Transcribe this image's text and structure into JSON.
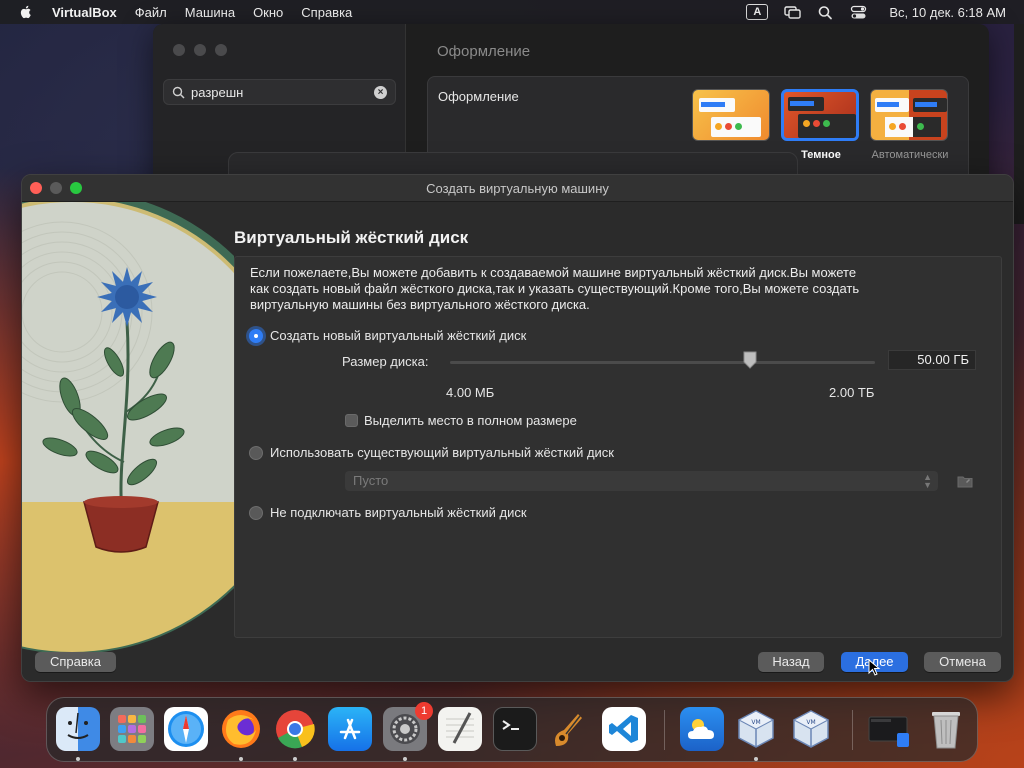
{
  "menubar": {
    "app_name": "VirtualBox",
    "items": [
      "Файл",
      "Машина",
      "Окно",
      "Справка"
    ],
    "kb_layout": "A",
    "clock": "Вс, 10 дек. 6:18 AM"
  },
  "settings_window": {
    "search_value": "разрешн",
    "title": "Оформление",
    "appearance_label": "Оформление",
    "themes": [
      {
        "name": "",
        "selected": false
      },
      {
        "name": "Темное",
        "selected": true
      },
      {
        "name": "Автоматически",
        "selected": false
      }
    ]
  },
  "dialog": {
    "title": "Создать виртуальную машину",
    "heading": "Виртуальный жёсткий диск",
    "description": "Если пожелаете,Вы можете добавить к создаваемой машине виртуальный жёсткий диск.Вы можете как создать новый файл жёсткого диска,так и указать существующий.Кроме того,Вы можете создать виртуальную машины без виртуального жёсткого диска.",
    "option_create": "Создать новый виртуальный жёсткий диск",
    "size_label": "Размер диска:",
    "size_value": "50.00 ГБ",
    "size_slider_fraction": 0.705,
    "range_min": "4.00 МБ",
    "range_max": "2.00 ТБ",
    "preallocate_label": "Выделить место в полном размере",
    "preallocate_checked": false,
    "option_existing": "Использовать существующий виртуальный жёсткий диск",
    "existing_placeholder": "Пусто",
    "option_none": "Не подключать виртуальный жёсткий диск",
    "selected_option": "create",
    "buttons": {
      "help": "Справка",
      "back": "Назад",
      "next": "Далее",
      "cancel": "Отмена"
    }
  },
  "dock": {
    "apps": [
      {
        "icon": "finder-icon",
        "running": true
      },
      {
        "icon": "launchpad-icon",
        "running": false
      },
      {
        "icon": "safari-icon",
        "running": false
      },
      {
        "icon": "firefox-icon",
        "running": true
      },
      {
        "icon": "chrome-icon",
        "running": true
      },
      {
        "icon": "app-store-icon",
        "running": false
      },
      {
        "icon": "system-settings-icon",
        "running": true,
        "badge": "1"
      },
      {
        "icon": "textedit-icon",
        "running": false
      },
      {
        "icon": "terminal-icon",
        "running": false
      },
      {
        "icon": "garageband-icon",
        "running": false
      },
      {
        "icon": "vscode-icon",
        "running": false
      },
      {
        "icon": "weather-icon",
        "running": false
      },
      {
        "icon": "virtualbox-icon",
        "running": true
      },
      {
        "icon": "virtualbox-vm-icon",
        "running": false
      },
      {
        "icon": "window-preview-icon",
        "running": false
      },
      {
        "icon": "trash-icon",
        "running": false
      }
    ]
  },
  "colors": {
    "accent": "#2b6fe0",
    "close": "#ff5f57",
    "maximize": "#28c840",
    "badge": "#ee3b30"
  }
}
